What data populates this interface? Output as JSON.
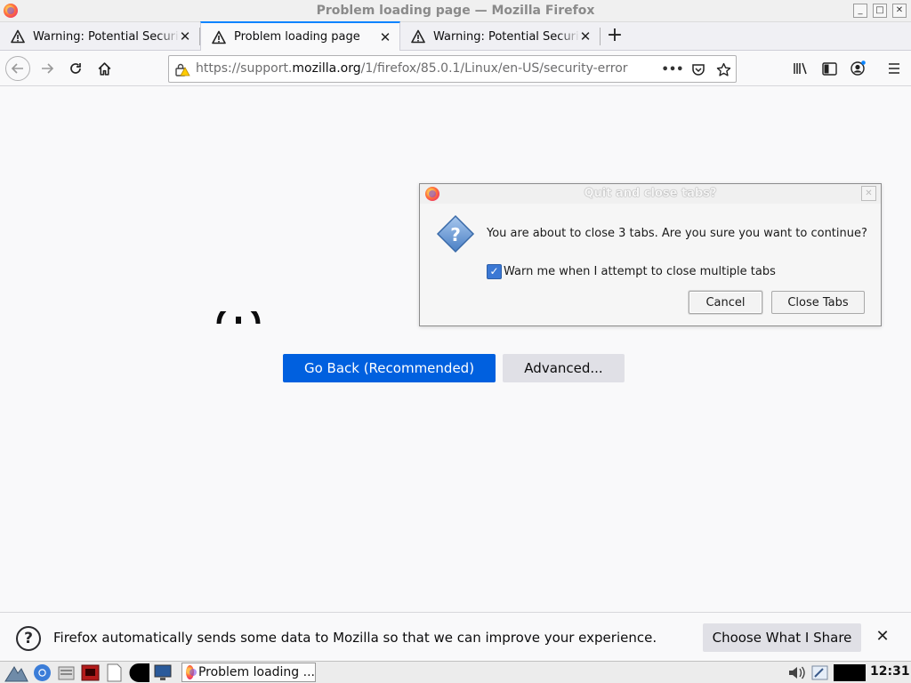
{
  "window": {
    "title": "Problem loading page — Mozilla Firefox"
  },
  "tabs": [
    {
      "label": "Warning: Potential Security Risk Ahead",
      "active": false
    },
    {
      "label": "Problem loading page",
      "active": true
    },
    {
      "label": "Warning: Potential Security Risk Ahead",
      "active": false
    }
  ],
  "navbar": {
    "url_prefix": "https://support.",
    "url_domain": "mozilla.org",
    "url_path": "/1/firefox/85.0.1/Linux/en-US/security-error",
    "page_actions": "•••"
  },
  "content": {
    "go_back_label": "Go Back (Recommended)",
    "advanced_label": "Advanced..."
  },
  "dialog": {
    "title": "Quit and close tabs?",
    "message": "You are about to close 3 tabs. Are you sure you want to continue?",
    "checkbox_label": "Warn me when I attempt to close multiple tabs",
    "checkbox_checked": true,
    "cancel_label": "Cancel",
    "close_tabs_label": "Close Tabs"
  },
  "notification": {
    "message": "Firefox automatically sends some data to Mozilla so that we can improve your experience.",
    "choose_label": "Choose What I Share"
  },
  "taskbar": {
    "task_label": "Problem loading ...",
    "clock": "12:31"
  },
  "colors": {
    "accent": "#0060df",
    "tab_highlight": "#0a84ff"
  }
}
